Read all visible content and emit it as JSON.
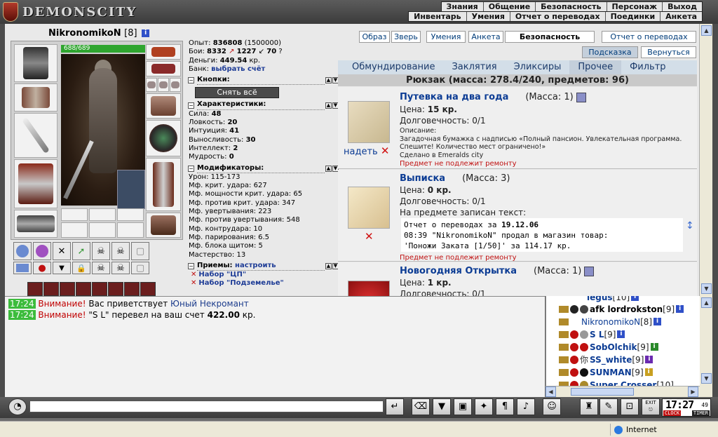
{
  "app": {
    "title": "DEMONSCITY"
  },
  "menu": {
    "row1": [
      "Знания",
      "Общение",
      "Безопасность",
      "Персонаж",
      "Выход"
    ],
    "row2": [
      "Инвентарь",
      "Умения",
      "Отчет о переводах",
      "Поединки",
      "Анкета"
    ]
  },
  "character": {
    "name": "NikronomikoN",
    "level": "[8]",
    "hp": "688/689"
  },
  "stats": {
    "exp_label": "Опыт:",
    "exp_value": "836808",
    "exp_next": "(1500000)",
    "fights_label": "Бои:",
    "fights_win": "8332",
    "fights_lose": "1227",
    "fights_draw": "70",
    "money_label": "Деньги:",
    "money_value": "449.54",
    "money_unit": "кр.",
    "bank_label": "Банк:",
    "bank_link": "выбрать счёт",
    "buttons_title": "Кнопки:",
    "unequip_all": "Снять всё",
    "chars_title": "Характеристики:",
    "chars": [
      {
        "label": "Сила:",
        "value": "48"
      },
      {
        "label": "Ловкость:",
        "value": "20"
      },
      {
        "label": "Интуиция:",
        "value": "41"
      },
      {
        "label": "Выносливость:",
        "value": "30"
      },
      {
        "label": "Интеллект:",
        "value": "2"
      },
      {
        "label": "Мудрость:",
        "value": "0"
      }
    ],
    "mods_title": "Модификаторы:",
    "mods": [
      "Урон: 115-173",
      "Мф. крит. удара: 627",
      "Мф. мощности крит. удара: 65",
      "Мф. против крит. удара: 347",
      "Мф. увертывания: 223",
      "Мф. против увертывания: 548",
      "Мф. контрудара: 10",
      "Мф. парирования: 6.5",
      "Мф. блока щитом: 5",
      "Мастерство: 13"
    ],
    "tricks_title": "Приемы:",
    "tricks_link": "настроить",
    "tricks": [
      "Набор \"ЦП\"",
      "Набор \"Подземелье\""
    ]
  },
  "top_buttons": [
    "Образ",
    "Зверь",
    "Умения",
    "Анкета",
    "Безопасность",
    "Отчет о переводах"
  ],
  "hint_button": "Подсказка",
  "back_button": "Вернуться",
  "tabs": [
    "Обмундирование",
    "Заклятия",
    "Эликсиры",
    "Прочее",
    "Фильтр"
  ],
  "active_tab": "Прочее",
  "bag_title": "Рюкзак (масса: 278.4/240, предметов: 96)",
  "items": [
    {
      "name": "Путевка на два года",
      "mass": "(Масса: 1)",
      "price_label": "Цена:",
      "price": "15 кр.",
      "durability": "Долговечность: 0/1",
      "desc_label": "Описание:",
      "desc": "Загадочная бумажка с надписью «Полный пансион. Увлекательная программа. Спешите! Количество мест ограничено!»",
      "made": "Сделано в Emeralds city",
      "repair": "Предмет не подлежит ремонту",
      "action": "надеть"
    },
    {
      "name": "Выписка",
      "mass": "(Масса: 3)",
      "price_label": "Цена:",
      "price": "0 кр.",
      "durability": "Долговечность: 0/1",
      "written": "На предмете записан текст:",
      "log_line1_a": "Отчет о переводах за ",
      "log_line1_b": "19.12.06",
      "log_line2": "08:39 \"NikronomikoN\" продал в магазин товар:",
      "log_line3": "'Поножи Заката [1/50]' за 114.17 кр.",
      "repair": "Предмет не подлежит ремонту"
    },
    {
      "name": "Новогодняя Открытка",
      "mass": "(Масса: 1)",
      "price_label": "Цена:",
      "price": "1 кр.",
      "durability": "Долговечность: 0/1"
    }
  ],
  "chat": [
    {
      "time": "17:24",
      "warn": "Внимание!",
      "text1": " Вас приветствует ",
      "who": "Юный Некромант",
      "text2": ""
    },
    {
      "time": "17:24",
      "warn": "Внимание!",
      "text1": " \"S L\" перевел на ваш счет ",
      "who": "422.00",
      "text2": " кр."
    }
  ],
  "users": [
    {
      "name": "legus",
      "level": "[10]"
    },
    {
      "name": "afk lordrokston",
      "level": "[9]"
    },
    {
      "name": "NikronomikoN",
      "level": "[8]"
    },
    {
      "name": "S L",
      "level": "[9]"
    },
    {
      "name": "SobOlchik",
      "level": "[9]"
    },
    {
      "name": "SS_white",
      "level": "[9]"
    },
    {
      "name": "SUNMAN",
      "level": "[9]"
    },
    {
      "name": "Super Crosser",
      "level": "[10]"
    }
  ],
  "clock": {
    "time": "17:27",
    "sec": "49",
    "left": "CLOCK",
    "right": "TIMER",
    "exit": "EXIT"
  },
  "status": {
    "zone": "Internet"
  },
  "colors": {
    "accent": "#0c3c94",
    "warn": "#c00000",
    "time_bg": "#3cbc3c",
    "hp": "#2fa52f"
  }
}
